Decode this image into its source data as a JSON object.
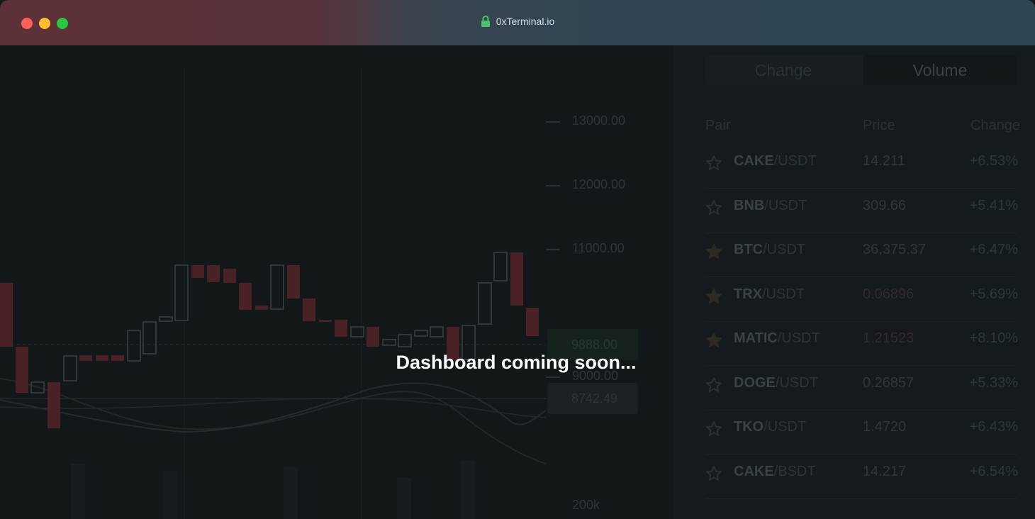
{
  "window": {
    "address": "0xTerminal.io",
    "traffic_lights": [
      "#fe5f57",
      "#febc2e",
      "#28c840"
    ]
  },
  "chart": {
    "axis_labels": [
      "13000.00",
      "12000.00",
      "11000.00",
      "9000.00",
      "200k"
    ],
    "current_price": "9888.00",
    "secondary_price": "8742.49"
  },
  "markets": {
    "tabs": [
      "Change",
      "Volume"
    ],
    "active_tab": "Volume",
    "headers": {
      "pair": "Pair",
      "price": "Price",
      "change": "Change"
    },
    "rows": [
      {
        "base": "CAKE",
        "quote": "/USDT",
        "price": "14.211",
        "change": "+6.53%",
        "starred": false
      },
      {
        "base": "BNB",
        "quote": "/USDT",
        "price": "309.66",
        "change": "+5.41%",
        "starred": false
      },
      {
        "base": "BTC",
        "quote": "/USDT",
        "price": "36,375.37",
        "change": "+6.47%",
        "starred": true
      },
      {
        "base": "TRX",
        "quote": "/USDT",
        "price": "0.06896",
        "change": "+5.69%",
        "starred": true
      },
      {
        "base": "MATIC",
        "quote": "/USDT",
        "price": "1.21523",
        "change": "+8.10%",
        "starred": true
      },
      {
        "base": "DOGE",
        "quote": "/USDT",
        "price": "0.26857",
        "change": "+5.33%",
        "starred": false
      },
      {
        "base": "TKO",
        "quote": "/USDT",
        "price": "1.4720",
        "change": "+6.43%",
        "starred": false
      },
      {
        "base": "CAKE",
        "quote": "/BSDT",
        "price": "14.217",
        "change": "+6.54%",
        "starred": false
      }
    ]
  },
  "overlay": {
    "message": "Dashboard coming soon..."
  },
  "colors": {
    "up_candle": "#4a2226",
    "down_candle": "#3a4044",
    "star": "#2e2a22"
  }
}
